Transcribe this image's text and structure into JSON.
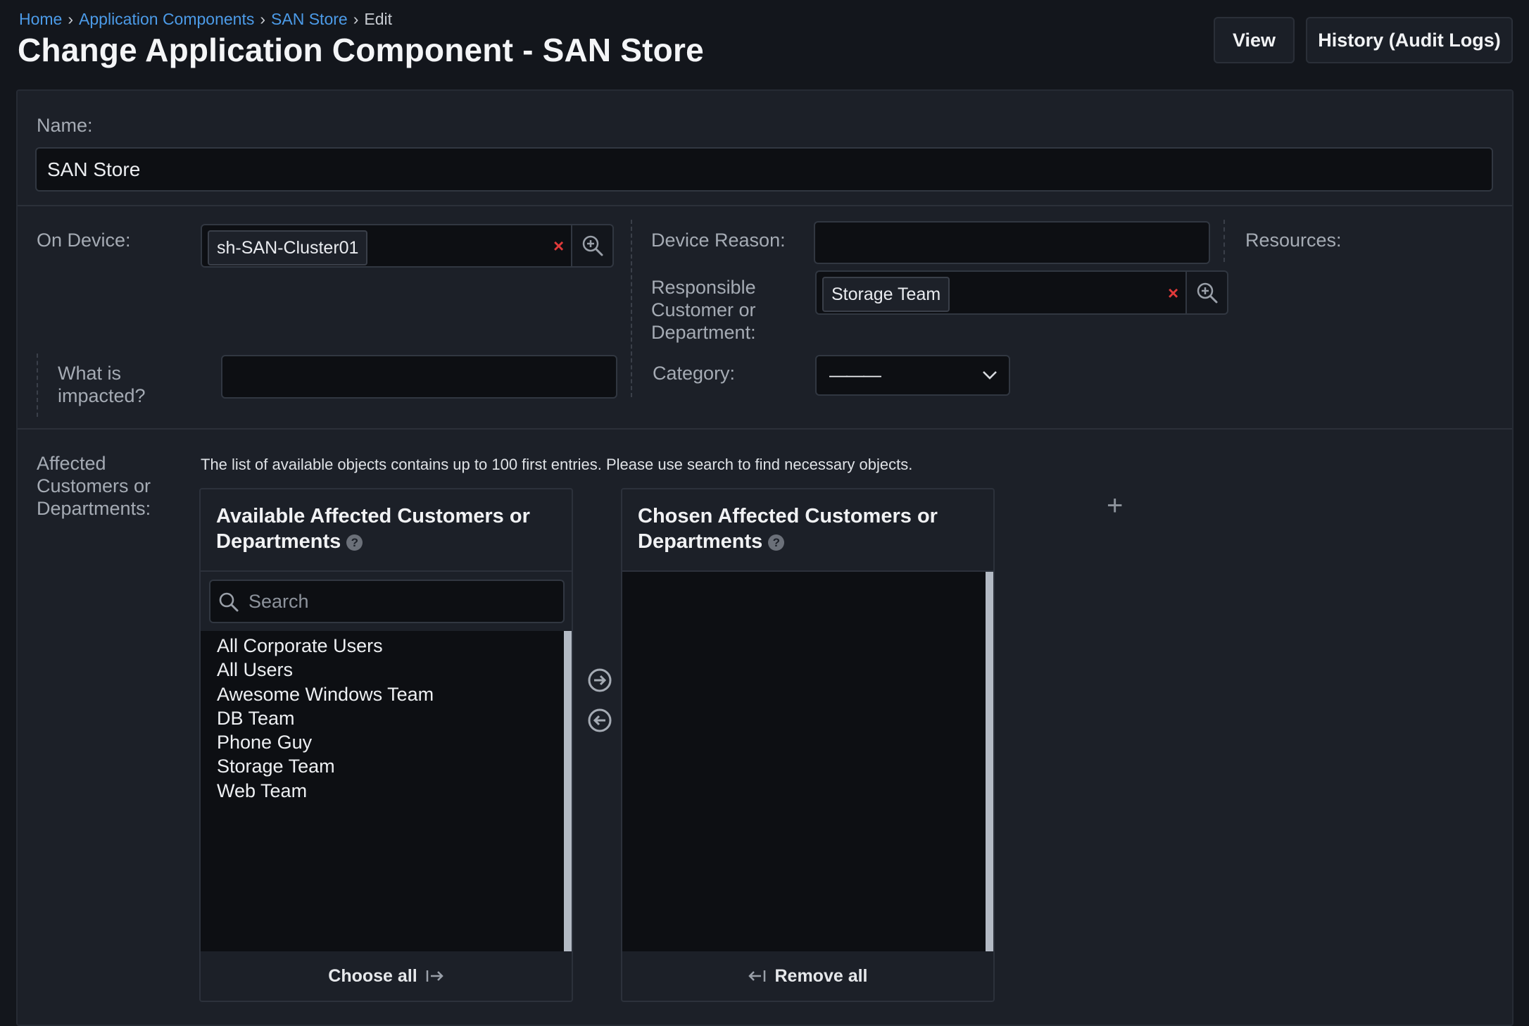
{
  "breadcrumb": {
    "items": [
      "Home",
      "Application Components",
      "SAN Store"
    ],
    "current": "Edit",
    "separator": "›"
  },
  "page_title": "Change Application Component - SAN Store",
  "header_buttons": {
    "view": "View",
    "history": "History (Audit Logs)"
  },
  "form": {
    "name": {
      "label": "Name:",
      "value": "SAN Store"
    },
    "on_device": {
      "label": "On Device:",
      "chip": "sh-SAN-Cluster01"
    },
    "device_reason": {
      "label": "Device Reason:",
      "value": ""
    },
    "resources": {
      "label": "Resources:"
    },
    "responsible": {
      "label_lines": [
        "Responsible",
        "Customer or",
        "Department:"
      ],
      "chip": "Storage Team"
    },
    "what_impacted": {
      "label_lines": [
        "What is",
        "impacted?"
      ],
      "value": ""
    },
    "category": {
      "label": "Category:",
      "value": "———"
    },
    "affected": {
      "label_lines": [
        "Affected",
        "Customers or",
        "Departments:"
      ],
      "help_text": "The list of available objects contains up to 100 first entries. Please use search to find necessary objects.",
      "available": {
        "title_lines": [
          "Available Affected Customers or",
          "Departments"
        ],
        "search_placeholder": "Search",
        "items": [
          "All Corporate Users",
          "All Users",
          "Awesome Windows Team",
          "DB Team",
          "Phone Guy",
          "Storage Team",
          "Web Team"
        ],
        "footer": "Choose all"
      },
      "chosen": {
        "title_lines": [
          "Chosen Affected Customers or",
          "Departments"
        ],
        "items": [],
        "footer": "Remove all"
      },
      "add_symbol": "+"
    }
  },
  "colors": {
    "background": "#13161c",
    "panel": "#1c2028",
    "link": "#4c9be8",
    "clear": "#e03a3a"
  }
}
